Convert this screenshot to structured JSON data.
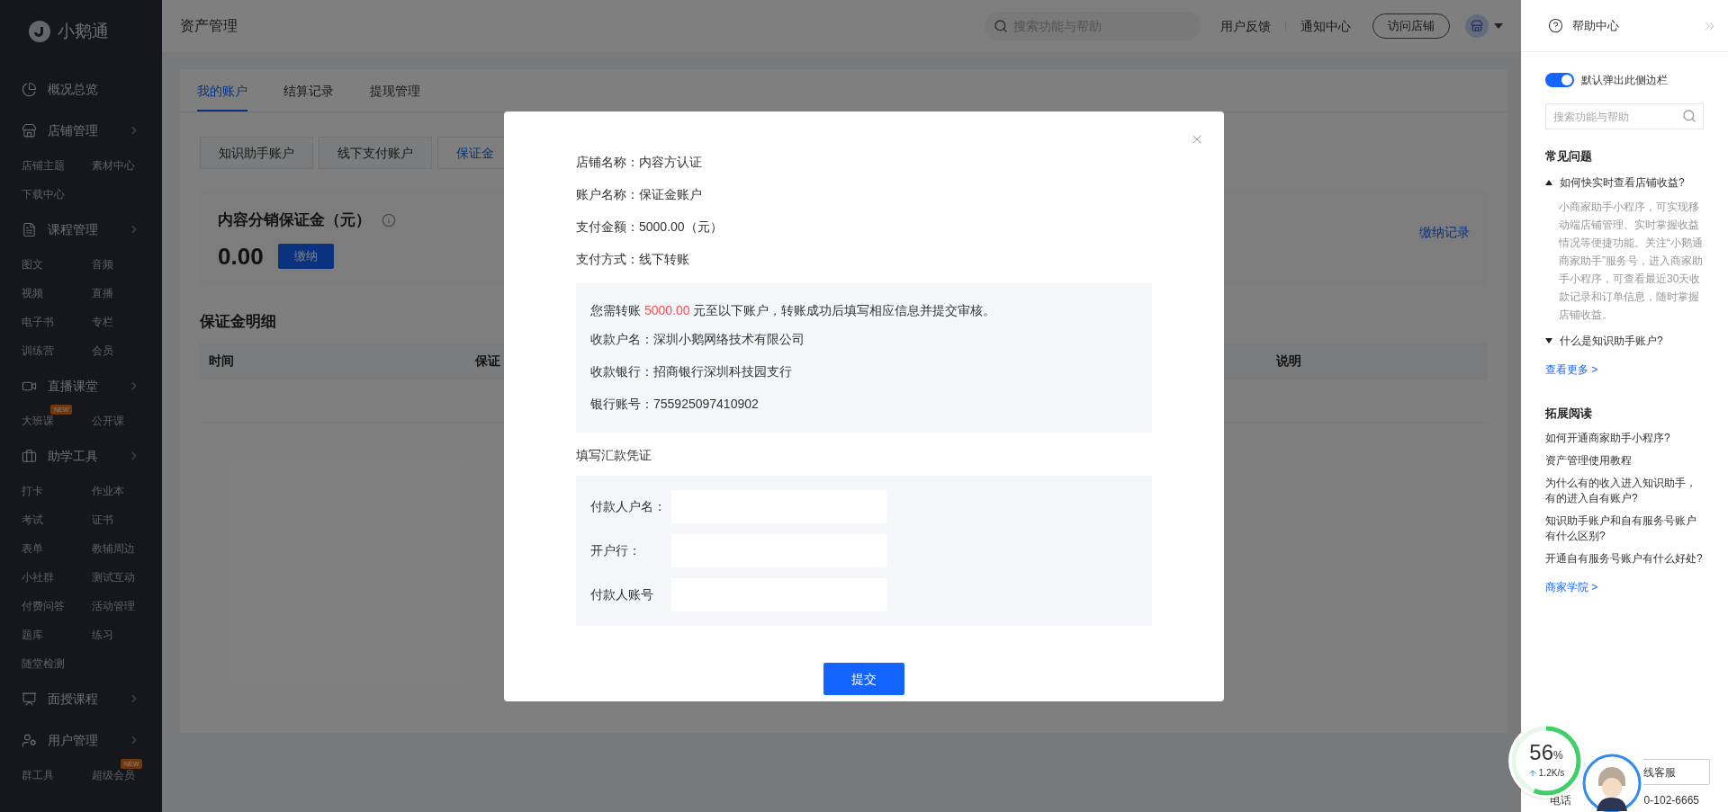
{
  "sidebar": {
    "logo": "小鹅通",
    "sections": [
      {
        "label": "概况总览",
        "chevron": false
      },
      {
        "label": "店铺管理",
        "chevron": true,
        "items": [
          {
            "label": "店铺主题"
          },
          {
            "label": "素材中心"
          },
          {
            "label": "下载中心"
          }
        ]
      },
      {
        "label": "课程管理",
        "chevron": true,
        "items": [
          {
            "label": "图文"
          },
          {
            "label": "音频"
          },
          {
            "label": "视频"
          },
          {
            "label": "直播"
          },
          {
            "label": "电子书"
          },
          {
            "label": "专栏"
          },
          {
            "label": "训练营"
          },
          {
            "label": "会员"
          }
        ]
      },
      {
        "label": "直播课堂",
        "chevron": true,
        "items": [
          {
            "label": "大班课",
            "badge": "NEW"
          },
          {
            "label": "公开课"
          }
        ]
      },
      {
        "label": "助学工具",
        "chevron": true,
        "items": [
          {
            "label": "打卡"
          },
          {
            "label": "作业本"
          },
          {
            "label": "考试"
          },
          {
            "label": "证书"
          },
          {
            "label": "表单"
          },
          {
            "label": "教辅周边"
          },
          {
            "label": "小社群"
          },
          {
            "label": "测试互动"
          },
          {
            "label": "付费问答"
          },
          {
            "label": "活动管理"
          },
          {
            "label": "题库"
          },
          {
            "label": "练习"
          },
          {
            "label": "随堂检测"
          }
        ]
      },
      {
        "label": "面授课程",
        "chevron": true
      },
      {
        "label": "用户管理",
        "chevron": true,
        "items": [
          {
            "label": "群工具"
          },
          {
            "label": "超级会员",
            "badge": "NEW"
          }
        ]
      }
    ]
  },
  "header": {
    "title": "资产管理",
    "search_placeholder": "搜索功能与帮助",
    "links": [
      "用户反馈",
      "通知中心"
    ],
    "visit_button": "访问店铺"
  },
  "tabs": [
    {
      "label": "我的账户",
      "selected": true
    },
    {
      "label": "结算记录",
      "selected": false
    },
    {
      "label": "提现管理",
      "selected": false
    }
  ],
  "account_tabs": [
    {
      "label": "知识助手账户",
      "selected": false
    },
    {
      "label": "线下支付账户",
      "selected": false
    },
    {
      "label": "保证金",
      "selected": true
    }
  ],
  "deposit": {
    "title": "内容分销保证金（元）",
    "amount": "0.00",
    "pay_button": "缴纳",
    "records_link": "缴纳记录"
  },
  "details": {
    "title": "保证金明细",
    "columns": [
      "时间",
      "保证",
      "说明"
    ]
  },
  "modal": {
    "info": [
      {
        "label": "店铺名称：",
        "value": "内容方认证"
      },
      {
        "label": "账户名称：",
        "value": "保证金账户"
      },
      {
        "label": "支付金额：",
        "value": "5000.00（元）"
      },
      {
        "label": "支付方式：",
        "value": "线下转账"
      }
    ],
    "notice": {
      "prefix": "您需转账 ",
      "amount": "5000.00",
      "suffix": " 元至以下账户，转账成功后填写相应信息并提交审核。"
    },
    "bank": [
      {
        "label": "收款户名：",
        "value": "深圳小鹅网络技术有限公司"
      },
      {
        "label": "收款银行：",
        "value": "招商银行深圳科技园支行"
      },
      {
        "label": "银行账号：",
        "value": "755925097410902"
      }
    ],
    "form_title": "填写汇款凭证",
    "fields": [
      {
        "label": "付款人户名："
      },
      {
        "label": "开户行："
      },
      {
        "label": "付款人账号"
      }
    ],
    "submit": "提交"
  },
  "help": {
    "title": "帮助中心",
    "toggle": {
      "label": "默认弹出此侧边栏",
      "on": true
    },
    "search_placeholder": "搜索功能与帮助",
    "faq_title": "常见问题",
    "faq": [
      {
        "question": "如何快实时查看店铺收益?",
        "expanded": true,
        "answer": "小商家助手小程序，可实现移动端店铺管理、实时掌握收益情况等便捷功能。关注“小鹅通商家助手”服务号，进入商家助手小程序，可查看最近30天收款记录和订单信息，随时掌握店铺收益。"
      },
      {
        "question": "什么是知识助手账户?",
        "expanded": false
      }
    ],
    "more": "查看更多 >",
    "reading_title": "拓展阅读",
    "reading": [
      "如何开通商家助手小程序?",
      "资产管理使用教程",
      "为什么有的收入进入知识助手，有的进入自有账户?",
      "知识助手账户和自有服务号账户有什么区别?",
      "开通自有服务号账户有什么好处?"
    ],
    "academy": "商家学院 >",
    "service_button": "线客服",
    "phone_label": "电话",
    "phone_number": "0-102-6665"
  },
  "speed_widget": {
    "value": "56",
    "unit": "%",
    "speed": "1.2K/s",
    "level": 0.56
  }
}
